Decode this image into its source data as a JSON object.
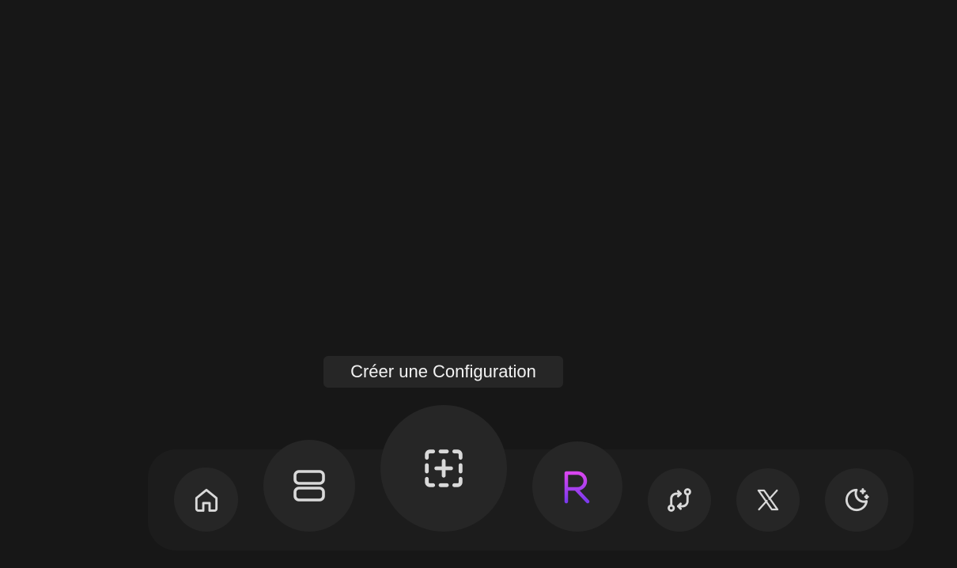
{
  "tooltip": {
    "text": "Créer une Configuration"
  },
  "dock": {
    "items": [
      {
        "id": "home",
        "icon": "home-icon"
      },
      {
        "id": "layout",
        "icon": "server-stack-icon"
      },
      {
        "id": "create-config",
        "icon": "dashed-plus-square-icon"
      },
      {
        "id": "app-r",
        "icon": "letter-r-logo-icon"
      },
      {
        "id": "sync",
        "icon": "swap-arrows-icon"
      },
      {
        "id": "x",
        "icon": "x-logo-icon"
      },
      {
        "id": "theme",
        "icon": "moon-stars-icon"
      }
    ]
  },
  "colors": {
    "background": "#171717",
    "dock": "#1c1c1c",
    "button": "#262626",
    "icon": "#d9d9d9",
    "accent_gradient": [
      "#c026d3",
      "#7c3aed"
    ]
  }
}
